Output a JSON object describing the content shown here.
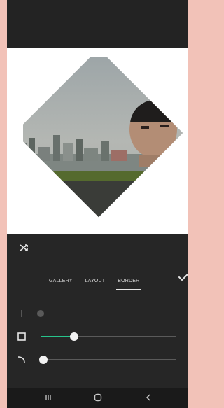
{
  "panel": {
    "tabs": [
      {
        "label": "GALLERY",
        "active": false
      },
      {
        "label": "LAYOUT",
        "active": false
      },
      {
        "label": "BORDER",
        "active": true
      }
    ],
    "sliders": [
      {
        "name": "spacing",
        "value": 0.0,
        "enabled": false,
        "icon": "spacing-icon"
      },
      {
        "name": "border",
        "value": 0.25,
        "enabled": true,
        "icon": "square-border-icon"
      },
      {
        "name": "corner",
        "value": 0.02,
        "enabled": true,
        "icon": "corner-radius-icon"
      }
    ]
  },
  "icons": {
    "shuffle": "shuffle-icon",
    "check": "check-icon",
    "nav": [
      "recents-icon",
      "home-icon",
      "back-icon"
    ]
  },
  "colors": {
    "accent": "#27c38b",
    "panel_bg": "#262626",
    "top_bg": "#232323",
    "outer_bg": "#f2c2b8"
  }
}
